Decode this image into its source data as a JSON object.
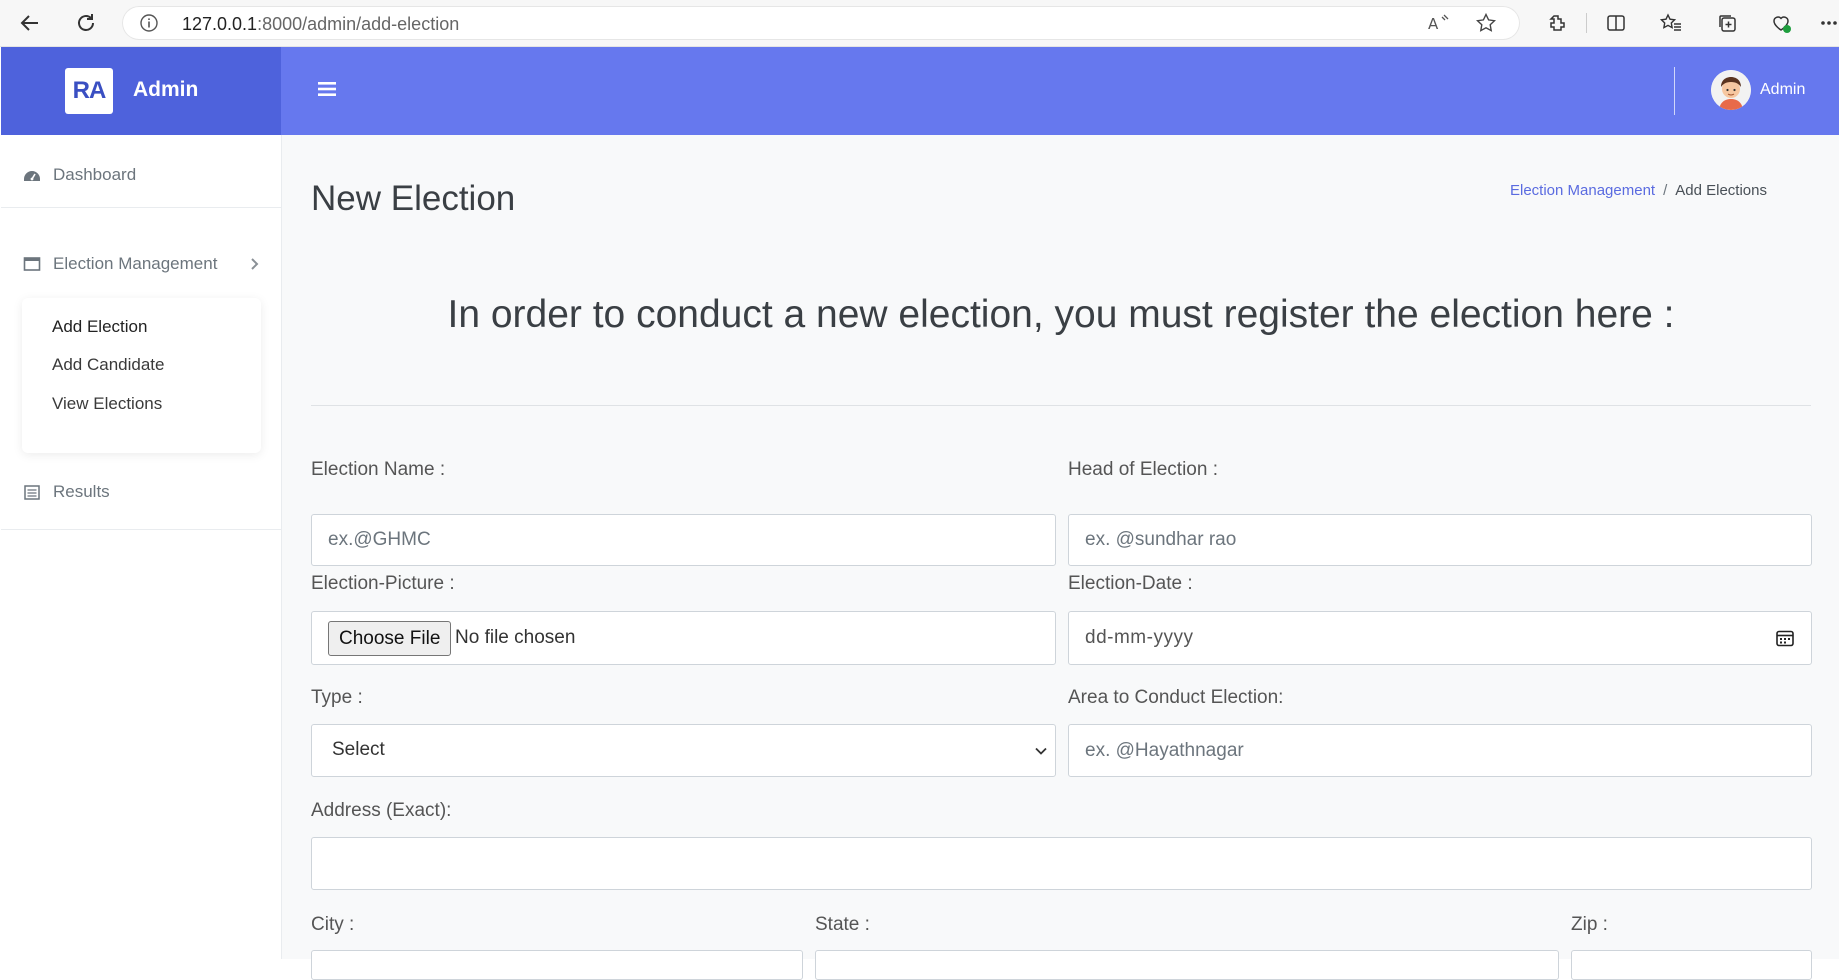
{
  "browser": {
    "url_host": "127.0.0.1",
    "url_path": ":8000/admin/add-election"
  },
  "brand": {
    "logo_text": "RA",
    "name": "Admin"
  },
  "header": {
    "user_name": "Admin"
  },
  "sidebar": {
    "items": [
      {
        "label": "Dashboard",
        "icon": "dashboard-icon"
      },
      {
        "label": "Election Management",
        "icon": "window-icon"
      },
      {
        "label": "Results",
        "icon": "calendar-icon"
      }
    ],
    "submenu": [
      {
        "label": "Add Election",
        "active": true
      },
      {
        "label": "Add Candidate"
      },
      {
        "label": "View Elections"
      }
    ]
  },
  "main": {
    "title": "New Election",
    "breadcrumb": {
      "parent": "Election Management",
      "separator": "/",
      "current": "Add Elections"
    },
    "intro": "In order to conduct a new election, you must register the election here :",
    "form": {
      "election_name_label": "Election Name :",
      "election_name_placeholder": "ex.@GHMC",
      "head_label": "Head of Election :",
      "head_placeholder": "ex. @sundhar rao",
      "picture_label": "Election-Picture :",
      "file_button": "Choose File",
      "file_status": "No file chosen",
      "date_label": "Election-Date :",
      "date_placeholder": "dd-mm-yyyy",
      "type_label": "Type :",
      "type_selected": "Select",
      "area_label": "Area to Conduct Election:",
      "area_placeholder": "ex. @Hayathnagar",
      "address_label": "Address (Exact):",
      "city_label": "City :",
      "state_label": "State :",
      "zip_label": "Zip :"
    }
  },
  "colors": {
    "brand_bg": "#4e62dc",
    "topbar_bg": "#6678ee",
    "link": "#5a6be0"
  }
}
